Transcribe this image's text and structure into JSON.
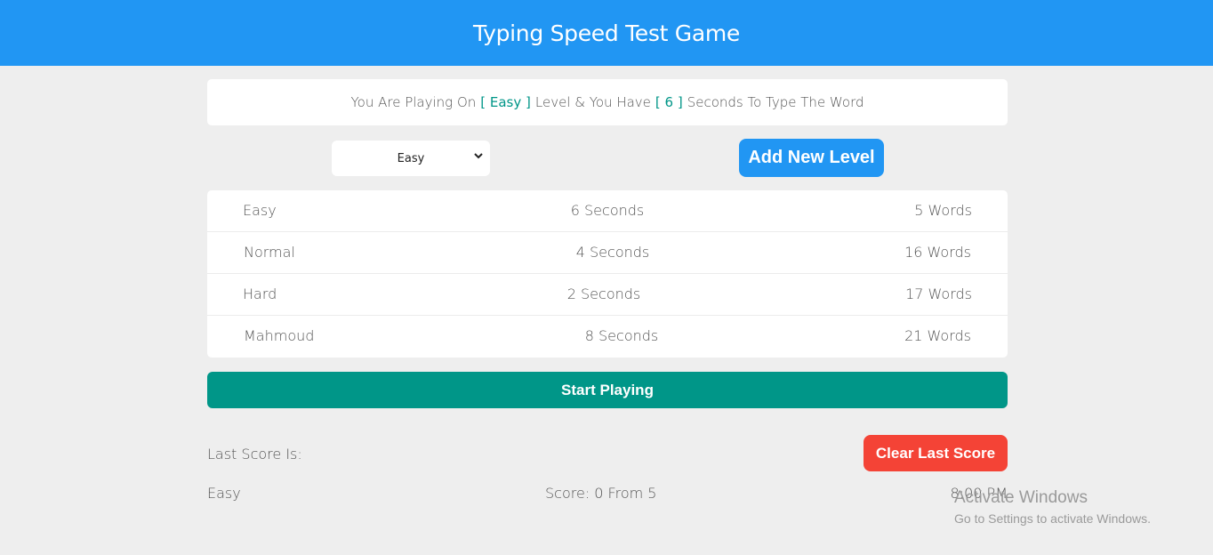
{
  "header": {
    "title": "Typing Speed Test Game"
  },
  "message": {
    "prefix": "You Are Playing On",
    "level": "[ Easy ]",
    "middle": "Level & You Have",
    "seconds": "[ 6 ]",
    "suffix": "Seconds To Type The Word"
  },
  "controls": {
    "selected_level": "Easy",
    "add_level_label": "Add New Level"
  },
  "levels": [
    {
      "name": "Easy",
      "seconds": "6 Seconds",
      "words": "5 Words"
    },
    {
      "name": "Normal",
      "seconds": "4 Seconds",
      "words": "16 Words"
    },
    {
      "name": "Hard",
      "seconds": "2 Seconds",
      "words": "17 Words"
    },
    {
      "name": "Mahmoud",
      "seconds": "8 Seconds",
      "words": "21 Words"
    }
  ],
  "start_label": "Start Playing",
  "score": {
    "label": "Last Score Is:",
    "clear_label": "Clear Last Score",
    "level": "Easy",
    "result": "Score: 0 From 5",
    "time": "8:00 PM"
  },
  "watermark": {
    "title": "Activate Windows",
    "subtitle": "Go to Settings to activate Windows."
  },
  "colors": {
    "header": "#2196f3",
    "accent": "#009688",
    "danger": "#f44336",
    "background": "#eeeeee"
  }
}
